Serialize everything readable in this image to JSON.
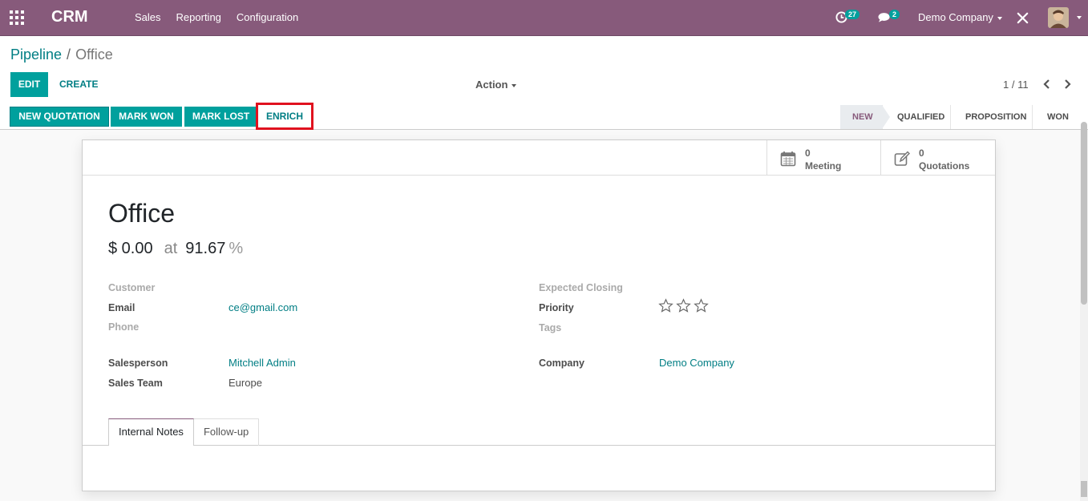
{
  "navbar": {
    "brand": "CRM",
    "menu": [
      "Sales",
      "Reporting",
      "Configuration"
    ],
    "activity_count": "27",
    "message_count": "2",
    "company": "Demo Company"
  },
  "breadcrumb": {
    "parent": "Pipeline",
    "separator": "/",
    "current": "Office"
  },
  "control": {
    "edit_label": "EDIT",
    "create_label": "CREATE",
    "action_label": "Action",
    "pager": "1 / 11"
  },
  "statusbar": {
    "buttons": [
      "NEW QUOTATION",
      "MARK WON",
      "MARK LOST",
      "ENRICH"
    ],
    "stages": [
      "NEW",
      "QUALIFIED",
      "PROPOSITION",
      "WON"
    ],
    "active_stage": "NEW"
  },
  "smart_buttons": [
    {
      "value": "0",
      "label": "Meeting",
      "icon": "calendar-icon"
    },
    {
      "value": "0",
      "label": "Quotations",
      "icon": "edit-icon"
    }
  ],
  "lead": {
    "title": "Office",
    "revenue": "$ 0.00",
    "at": "at",
    "probability": "91.67",
    "percent": "%"
  },
  "fields_left": {
    "customer_label": "Customer",
    "email_label": "Email",
    "email_value": "ce@gmail.com",
    "phone_label": "Phone",
    "salesperson_label": "Salesperson",
    "salesperson_value": "Mitchell Admin",
    "team_label": "Sales Team",
    "team_value": "Europe"
  },
  "fields_right": {
    "closing_label": "Expected Closing",
    "priority_label": "Priority",
    "priority_stars": 0,
    "priority_max": 3,
    "tags_label": "Tags",
    "company_label": "Company",
    "company_value": "Demo Company"
  },
  "tabs": [
    "Internal Notes",
    "Follow-up"
  ],
  "colors": {
    "brand": "#875a7b",
    "primary": "#00a09d",
    "link": "#017e84",
    "highlight": "#e0121f"
  }
}
